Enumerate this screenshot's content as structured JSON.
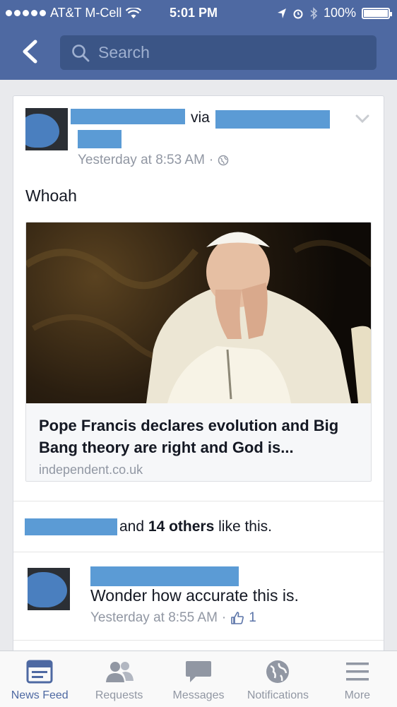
{
  "status_bar": {
    "carrier": "AT&T M-Cell",
    "time": "5:01 PM",
    "battery": "100%"
  },
  "header": {
    "search_placeholder": "Search"
  },
  "post": {
    "via_text": "via",
    "timestamp": "Yesterday at 8:53 AM",
    "separator": "·",
    "text": "Whoah",
    "link": {
      "title": "Pope Francis declares evolution and Big Bang theory are right and God is...",
      "domain": "independent.co.uk"
    },
    "likes": {
      "and": "and",
      "others": "14 others",
      "suffix": "like this."
    },
    "comment": {
      "text": "Wonder how accurate this is.",
      "timestamp": "Yesterday at 8:55 AM",
      "separator": "·",
      "like_count": "1"
    }
  },
  "tabs": [
    {
      "label": "News Feed",
      "icon": "news-feed-icon",
      "active": true
    },
    {
      "label": "Requests",
      "icon": "requests-icon",
      "active": false
    },
    {
      "label": "Messages",
      "icon": "messages-icon",
      "active": false
    },
    {
      "label": "Notifications",
      "icon": "notifications-icon",
      "active": false
    },
    {
      "label": "More",
      "icon": "more-icon",
      "active": false
    }
  ],
  "colors": {
    "header": "#4e69a2",
    "active_tab": "#4e69a2",
    "redaction": "#5b9bd5"
  }
}
